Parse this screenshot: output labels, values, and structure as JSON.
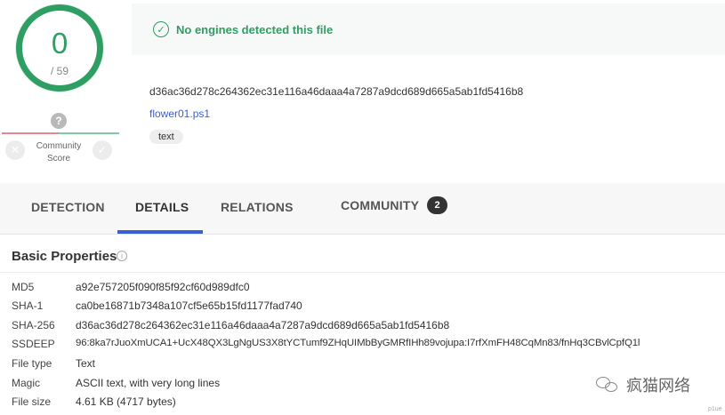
{
  "score": {
    "detected": "0",
    "total": "/ 59"
  },
  "community": {
    "question_mark": "?",
    "label_line1": "Community",
    "label_line2": "Score",
    "negative": "✕",
    "positive": "✓"
  },
  "banner": {
    "text": "No engines detected this file"
  },
  "file": {
    "hash": "d36ac36d278c264362ec31e116a46daaa4a7287a9dcd689d665a5ab1fd5416b8",
    "name": "flower01.ps1",
    "tag": "text"
  },
  "tabs": [
    {
      "label": "DETECTION"
    },
    {
      "label": "DETAILS"
    },
    {
      "label": "RELATIONS"
    },
    {
      "label": "COMMUNITY",
      "badge": "2"
    }
  ],
  "basic_properties": {
    "title": "Basic Properties",
    "rows": [
      {
        "key": "MD5",
        "value": "a92e757205f090f85f92cf60d989dfc0"
      },
      {
        "key": "SHA-1",
        "value": "ca0be16871b7348a107cf5e65b15fd1177fad740"
      },
      {
        "key": "SHA-256",
        "value": "d36ac36d278c264362ec31e116a46daaa4a7287a9dcd689d665a5ab1fd5416b8"
      },
      {
        "key": "SSDEEP",
        "value": "96:8ka7rJuoXmUCA1+UcX48QX3LgNgUS3X8tYCTumf9ZHqUIMbByGMRfIHh89vojupa:I7rfXmFH48CqMn83/fnHq3CBvlCpfQ1l"
      },
      {
        "key": "File type",
        "value": "Text"
      },
      {
        "key": "Magic",
        "value": "ASCII text, with very long lines"
      },
      {
        "key": "File size",
        "value": "4.61 KB (4717 bytes)"
      }
    ]
  },
  "watermark": {
    "text": "疯猫网络",
    "corner": "p1ue"
  }
}
